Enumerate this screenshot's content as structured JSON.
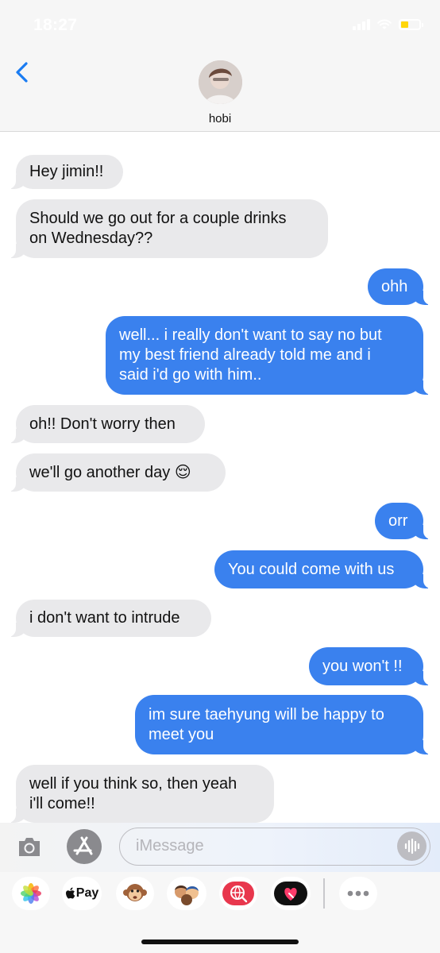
{
  "status": {
    "time": "18:27"
  },
  "header": {
    "contact_name": "hobi"
  },
  "messages": [
    {
      "dir": "in",
      "text": "Hey jimin!!"
    },
    {
      "dir": "in",
      "text": "Should we go out for a couple drinks\non Wednesday??"
    },
    {
      "dir": "out",
      "text": "ohh"
    },
    {
      "dir": "out",
      "text": "well... i really don't want to say no but\nmy best friend already told me and i\nsaid i'd go with him.."
    },
    {
      "dir": "in",
      "text": "oh!! Don't worry then"
    },
    {
      "dir": "in",
      "text": "we'll go another day 😌"
    },
    {
      "dir": "out",
      "text": "orr"
    },
    {
      "dir": "out",
      "text": "You could come with us"
    },
    {
      "dir": "in",
      "text": "i don't want to intrude"
    },
    {
      "dir": "out",
      "text": "you won't !!"
    },
    {
      "dir": "out",
      "text": "im sure taehyung will be happy to\nmeet you"
    },
    {
      "dir": "in",
      "text": "well if you think so, then yeah\ni'll come!!"
    }
  ],
  "composer": {
    "placeholder": "iMessage"
  },
  "apps": {
    "apple_pay_label": "Pay",
    "items": [
      "photos-app",
      "apple-pay-app",
      "animoji-app",
      "memoji-stickers-app",
      "web-search-app",
      "digital-touch-app",
      "more-apps"
    ]
  },
  "colors": {
    "outgoing": "#3a81ee",
    "incoming": "#e9e9eb",
    "accent": "#1a7cf2"
  }
}
